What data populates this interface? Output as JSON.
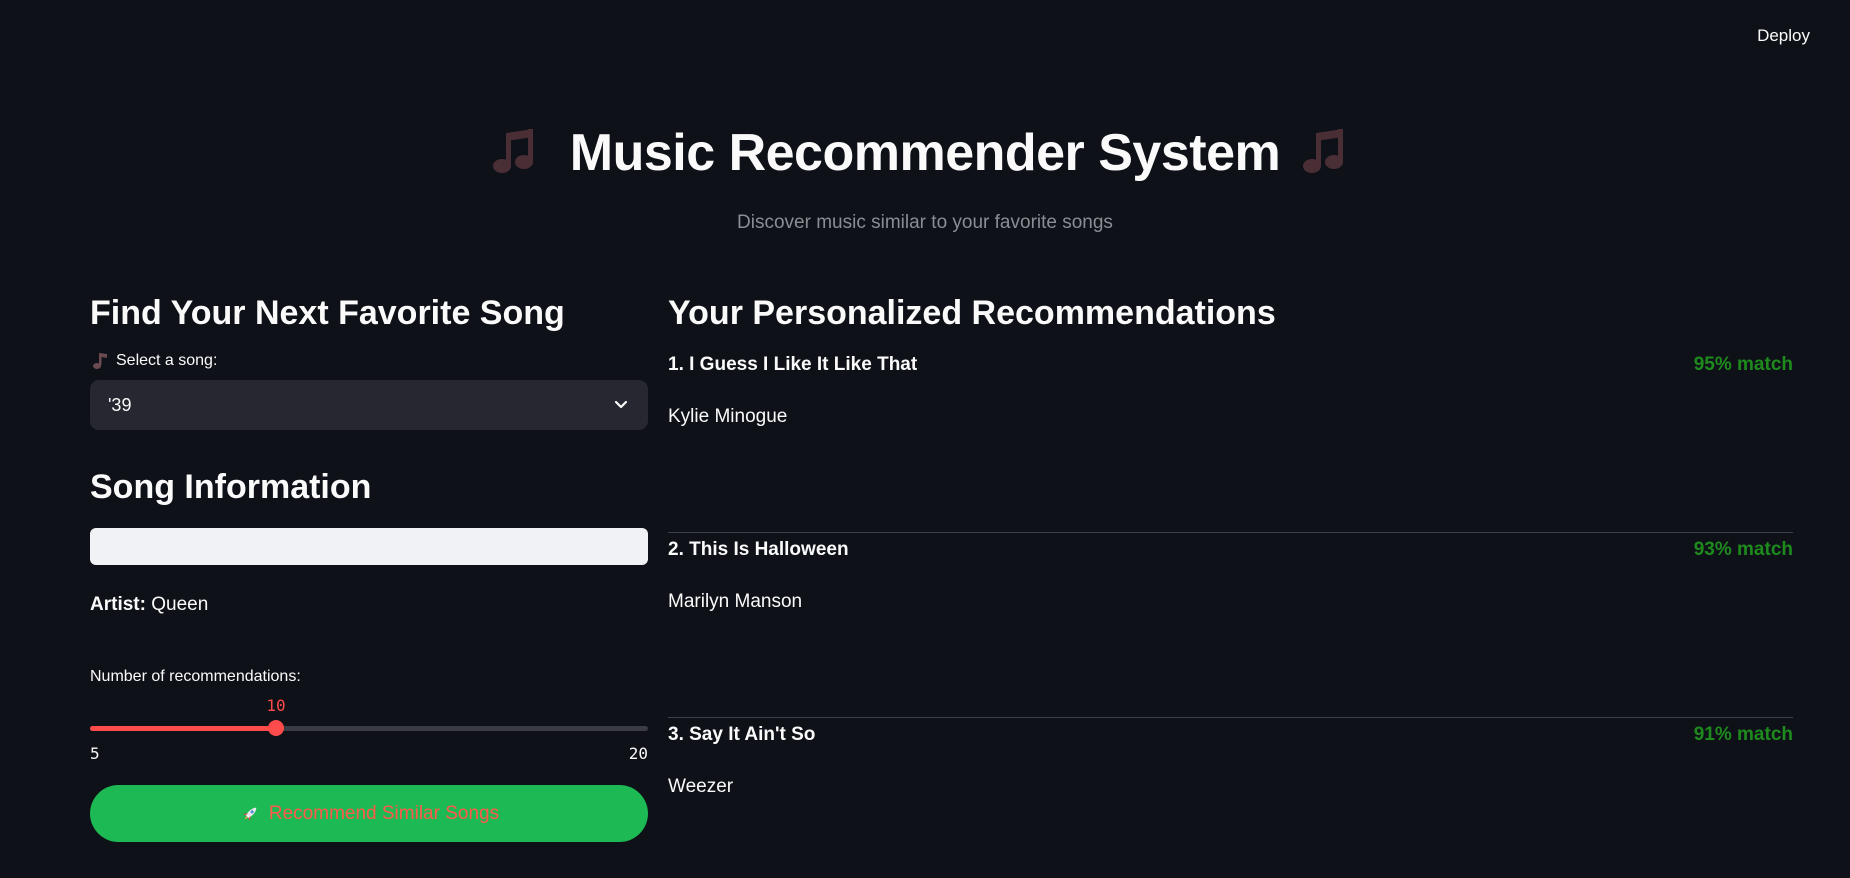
{
  "topbar": {
    "deploy_label": "Deploy"
  },
  "header": {
    "title": "Music Recommender System",
    "subtitle": "Discover music similar to your favorite songs",
    "title_icon": "music-notes-icon"
  },
  "finder": {
    "heading": "Find Your Next Favorite Song",
    "select_label": "Select a song:",
    "selected_song": "'39"
  },
  "song_info": {
    "heading": "Song Information",
    "artist_label": "Artist:",
    "artist_value": "Queen"
  },
  "slider": {
    "label": "Number of recommendations:",
    "value": 10,
    "min": 5,
    "max": 20,
    "value_text": "10",
    "min_text": "5",
    "max_text": "20"
  },
  "recommend_button": {
    "label": "Recommend Similar Songs",
    "icon": "rocket-icon"
  },
  "recommendations": {
    "heading": "Your Personalized Recommendations",
    "items": [
      {
        "title": "1. I Guess I Like It Like That",
        "artist": "Kylie Minogue",
        "match": "95% match"
      },
      {
        "title": "2. This Is Halloween",
        "artist": "Marilyn Manson",
        "match": "93% match"
      },
      {
        "title": "3. Say It Ain't So",
        "artist": "Weezer",
        "match": "91% match"
      }
    ]
  },
  "colors": {
    "background": "#0e1117",
    "accent": "#ff4b4b",
    "button": "#1db954",
    "match": "#1e8a1e"
  }
}
